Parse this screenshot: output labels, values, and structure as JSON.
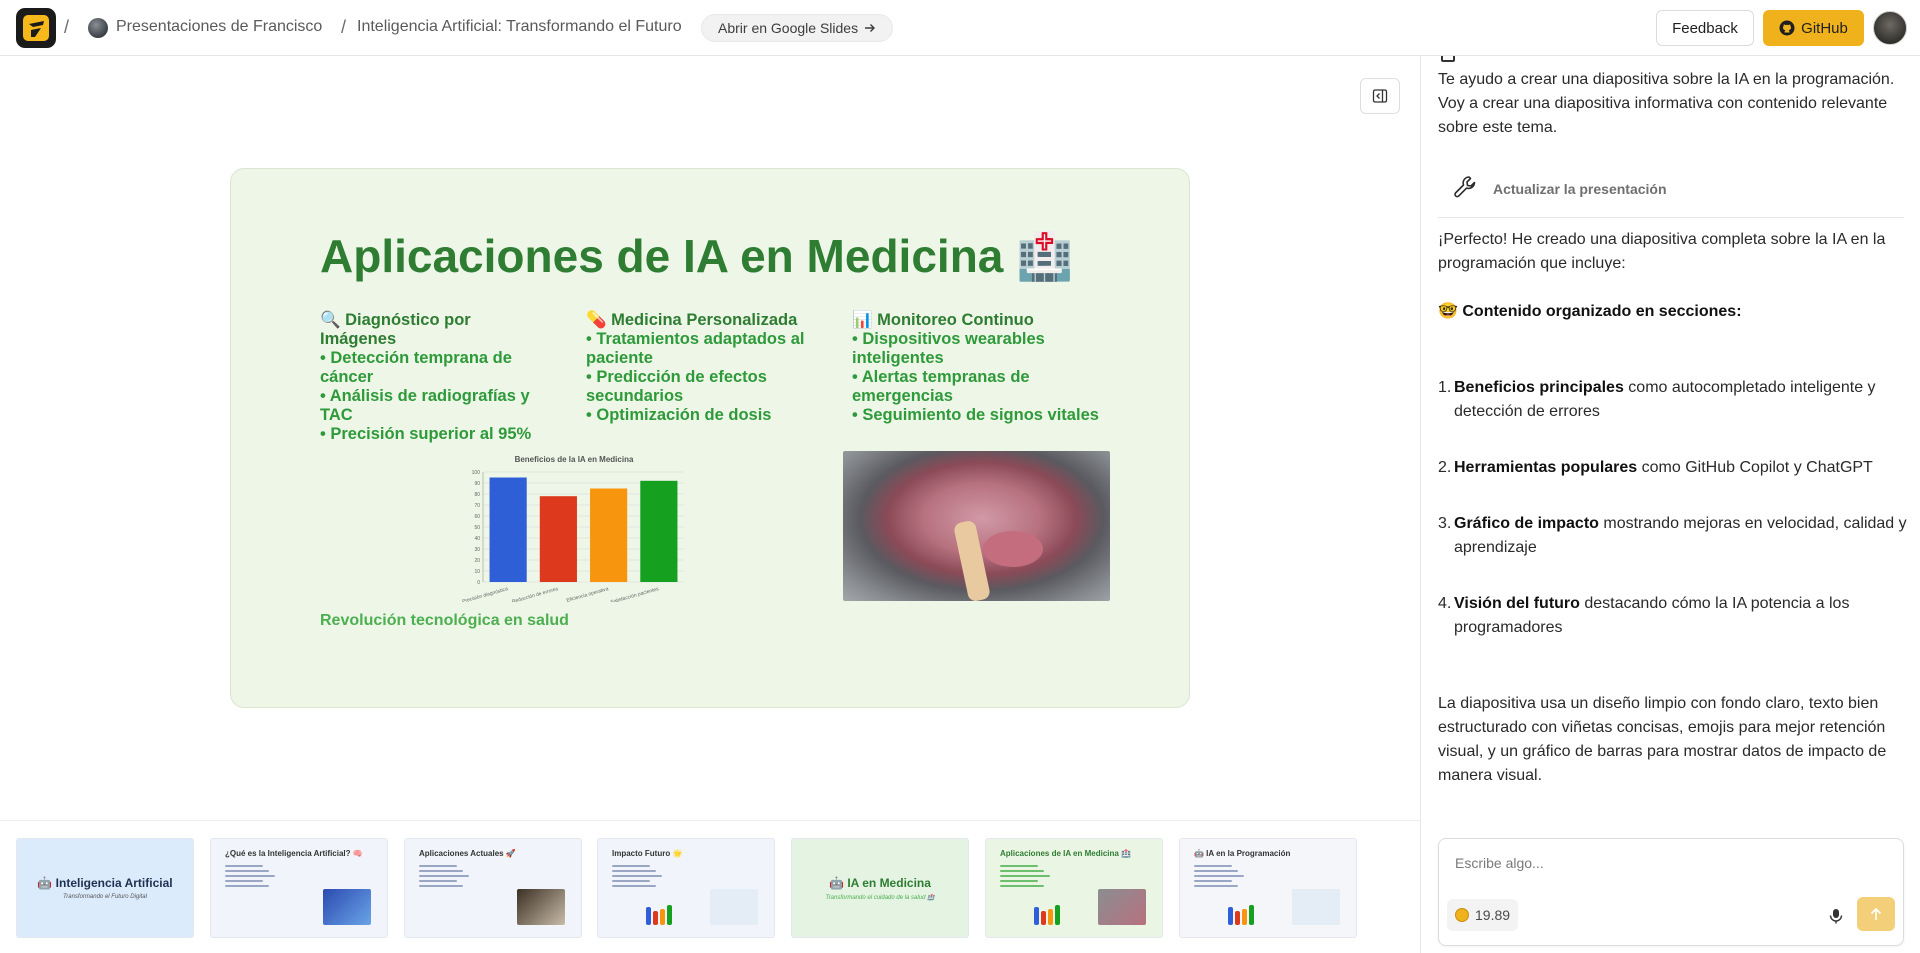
{
  "header": {
    "breadcrumb": {
      "separator": "/",
      "owner": "Presentaciones de Francisco",
      "presentation": "Inteligencia Artificial: Transformando el Futuro"
    },
    "open_google_slides": "Abrir en Google Slides",
    "feedback_label": "Feedback",
    "github_label": "GitHub"
  },
  "slide": {
    "title": "Aplicaciones de IA en Medicina 🏥",
    "columns": [
      {
        "heading": "🔍 Diagnóstico por Imágenes",
        "bullets": [
          "• Detección temprana de cáncer",
          "• Análisis de radiografías y TAC",
          "• Precisión superior al 95%"
        ]
      },
      {
        "heading": "💊 Medicina Personalizada",
        "bullets": [
          "• Tratamientos adaptados al paciente",
          "• Predicción de efectos secundarios",
          "• Optimización de dosis"
        ]
      },
      {
        "heading": "📊 Monitoreo Continuo",
        "bullets": [
          "• Dispositivos wearables inteligentes",
          "• Alertas tempranas de emergencias",
          "• Seguimiento de signos vitales"
        ]
      }
    ],
    "footer": "Revolución tecnológica en salud"
  },
  "chart_data": {
    "type": "bar",
    "title": "Beneficios de la IA en Medicina",
    "categories": [
      "Precisión diagnóstica",
      "Reducción de errores",
      "Eficiencia operativa",
      "Satisfacción pacientes"
    ],
    "values": [
      95,
      78,
      85,
      92
    ],
    "colors": [
      "#2e5fd6",
      "#dd3a1d",
      "#f7960e",
      "#15a01f"
    ],
    "ylim": [
      0,
      100
    ],
    "yticks": [
      "0",
      "10",
      "20",
      "30",
      "40",
      "50",
      "60",
      "70",
      "80",
      "90",
      "100"
    ],
    "grid": true,
    "xlabel": "",
    "ylabel": ""
  },
  "thumbnails": [
    {
      "title": "🤖 Inteligencia Artificial",
      "subtitle": "Transformando el Futuro Digital",
      "bg": "#dcebfb",
      "style": "title"
    },
    {
      "title": "¿Qué es la Inteligencia Artificial? 🧠",
      "bg": "#f1f5fb",
      "style": "content"
    },
    {
      "title": "Aplicaciones Actuales 🚀",
      "bg": "#f1f5fb",
      "style": "content"
    },
    {
      "title": "Impacto Futuro 🌟",
      "bg": "#f1f5fb",
      "style": "chart"
    },
    {
      "title": "🤖 IA en Medicina",
      "subtitle": "Transformando el cuidado de la salud 🏥",
      "bg": "#e5f3e3",
      "style": "title"
    },
    {
      "title": "Aplicaciones de IA en Medicina 🏥",
      "bg": "#eaf5e4",
      "style": "chart"
    },
    {
      "title": "🤖 IA en la Programación",
      "bg": "#f4f6f9",
      "style": "chart"
    }
  ],
  "chat": {
    "intro": "Te ayudo a crear una diapositiva sobre la IA en la programación. Voy a crear una diapositiva informativa con contenido relevante sobre este tema.",
    "tool_label": "Actualizar la presentación",
    "reply_intro": "¡Perfecto! He creado una diapositiva completa sobre la IA en la programación que incluye:",
    "sections_heading": "🤓 Contenido organizado en secciones:",
    "items": [
      {
        "num": "1.",
        "bold": "Beneficios principales",
        "text": " como autocompletado inteligente y detección de errores"
      },
      {
        "num": "2.",
        "bold": "Herramientas populares",
        "text": " como GitHub Copilot y ChatGPT"
      },
      {
        "num": "3.",
        "bold": "Gráfico de impacto",
        "text": " mostrando mejoras en velocidad, calidad y aprendizaje"
      },
      {
        "num": "4.",
        "bold": "Visión del futuro",
        "text": " destacando cómo la IA potencia a los programadores"
      }
    ],
    "closing": "La diapositiva usa un diseño limpio con fondo claro, texto bien estructurado con viñetas concisas, emojis para mejor retención visual, y un gráfico de barras para mostrar datos de impacto de manera visual.",
    "input_placeholder": "Escribe algo...",
    "credits": "19.89"
  },
  "icons": [
    "logo-icon",
    "arrow-right-icon",
    "github-icon",
    "panel-toggle-icon",
    "wrench-icon",
    "coin-icon",
    "mic-icon",
    "send-arrow-icon"
  ],
  "colors": {
    "accent": "#f0b21c",
    "slide_bg": "#eef6e8",
    "slide_title": "#2e7d32",
    "slide_text": "#2e9a3a"
  }
}
